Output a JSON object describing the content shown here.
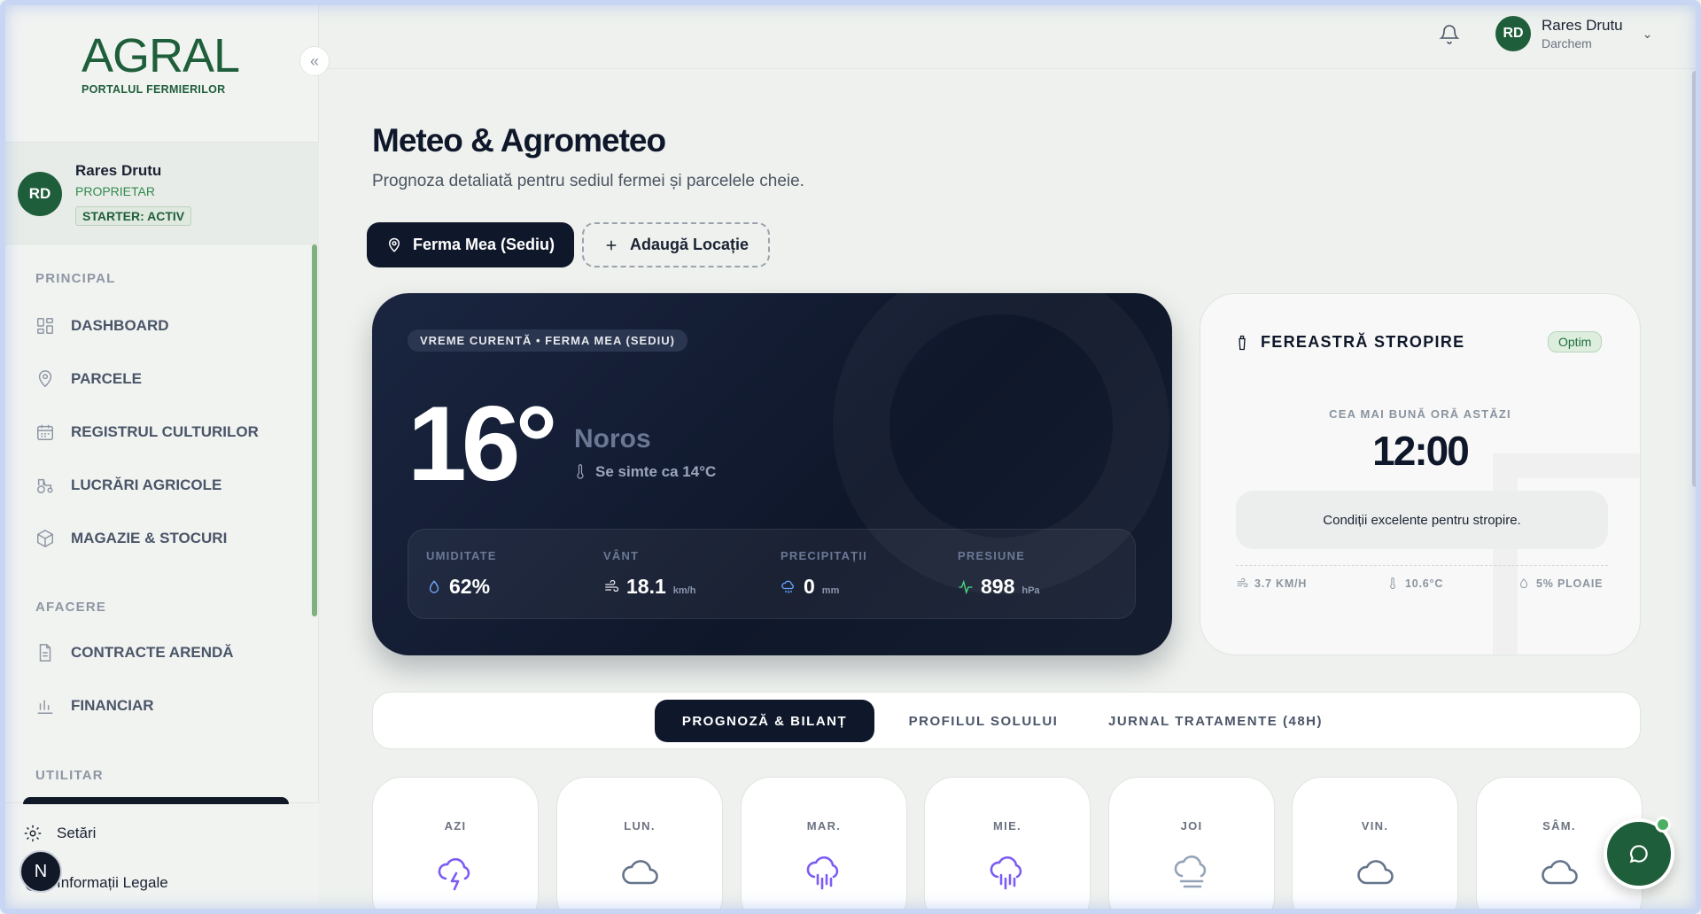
{
  "sidebar": {
    "logo": {
      "main": "AGRAL",
      "sub": "PORTALUL FERMIERILOR"
    },
    "collapse_icon": "double-chevron-left-icon",
    "profile": {
      "initials": "RD",
      "name": "Rares Drutu",
      "role": "PROPRIETAR",
      "plan": "STARTER: ACTIV"
    },
    "sections": [
      {
        "title": "PRINCIPAL",
        "items": [
          {
            "label": "DASHBOARD",
            "icon": "grid-icon"
          },
          {
            "label": "PARCELE",
            "icon": "map-pin-icon"
          },
          {
            "label": "REGISTRUL CULTURILOR",
            "icon": "calendar-icon"
          },
          {
            "label": "LUCRĂRI AGRICOLE",
            "icon": "tractor-icon"
          },
          {
            "label": "MAGAZIE & STOCURI",
            "icon": "box-icon"
          }
        ]
      },
      {
        "title": "AFACERE",
        "items": [
          {
            "label": "CONTRACTE ARENDĂ",
            "icon": "document-icon"
          },
          {
            "label": "FINANCIAR",
            "icon": "bar-chart-icon"
          }
        ]
      },
      {
        "title": "UTILITAR",
        "items": []
      }
    ],
    "bottom": [
      {
        "label": "Setări",
        "icon": "gear-icon"
      },
      {
        "label": "Informații Legale",
        "icon": "info-icon"
      }
    ],
    "n_badge": "N"
  },
  "topbar": {
    "bell_icon": "bell-icon",
    "user": {
      "initials": "RD",
      "name": "Rares Drutu",
      "company": "Darchem"
    }
  },
  "main": {
    "title": "Meteo & Agrometeo",
    "subtitle": "Prognoza detaliată pentru sediul fermei și parcelele cheie.",
    "locations": {
      "active": "Ferma Mea (Sediu)",
      "add": "Adaugă Locație"
    },
    "weather": {
      "tag": "VREME CURENTĂ • FERMA MEA (SEDIU)",
      "temperature": "16°",
      "condition": "Noros",
      "feels_like": "Se simte ca 14°C",
      "stats": [
        {
          "label": "UMIDITATE",
          "value": "62%",
          "unit": "",
          "icon": "droplet-icon",
          "color": "#7aa7ff"
        },
        {
          "label": "VÂNT",
          "value": "18.1",
          "unit": "km/h",
          "icon": "wind-icon",
          "color": "#e5e7eb"
        },
        {
          "label": "PRECIPITAȚII",
          "value": "0",
          "unit": "mm",
          "icon": "rain-cloud-icon",
          "color": "#60a5fa"
        },
        {
          "label": "PRESIUNE",
          "value": "898",
          "unit": "hPa",
          "icon": "activity-icon",
          "color": "#4ade80"
        }
      ]
    },
    "spray": {
      "title": "FEREASTRĂ STROPIRE",
      "badge": "Optim",
      "best_label": "CEA MAI BUNĂ ORĂ ASTĂZI",
      "best_time": "12:00",
      "message": "Condiții excelente pentru stropire.",
      "stats": [
        {
          "label": "3.7 KM/H",
          "icon": "wind-icon"
        },
        {
          "label": "10.6°C",
          "icon": "thermometer-icon"
        },
        {
          "label": "5% PLOAIE",
          "icon": "droplet-icon"
        }
      ]
    },
    "tabs": [
      "PROGNOZĂ & BILANȚ",
      "PROFILUL SOLULUI",
      "JURNAL TRATAMENTE (48H)"
    ],
    "forecast": [
      {
        "day": "AZI",
        "icon": "thunderstorm-icon",
        "color": "#7c5cf5"
      },
      {
        "day": "LUN.",
        "icon": "cloud-icon",
        "color": "#64748b"
      },
      {
        "day": "MAR.",
        "icon": "rain-cloud-icon",
        "color": "#7c5cf5"
      },
      {
        "day": "MIE.",
        "icon": "rain-cloud-icon",
        "color": "#7c5cf5"
      },
      {
        "day": "JOI",
        "icon": "fog-cloud-icon",
        "color": "#94a3b8"
      },
      {
        "day": "VIN.",
        "icon": "cloud-icon",
        "color": "#64748b"
      },
      {
        "day": "SÂM.",
        "icon": "cloud-icon",
        "color": "#64748b"
      }
    ],
    "chat_icon": "chat-bubble-icon"
  }
}
